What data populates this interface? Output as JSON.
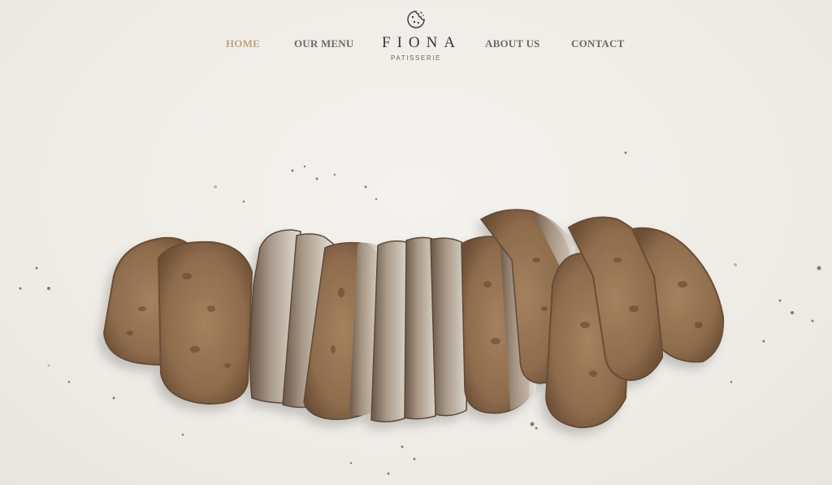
{
  "nav": {
    "home": "HOME",
    "menu": "OUR MENU",
    "about": "ABOUT US",
    "contact": "CONTACT"
  },
  "brand": {
    "name": "FIONA",
    "tagline": "PATISSERIE",
    "icon": "cookie-icon"
  },
  "colors": {
    "background": "#f1efeb",
    "nav_text": "#6f6a66",
    "nav_active": "#c2a37c",
    "brand_text": "#3a3633",
    "bread_crust": "#7a5a3e",
    "bread_crumb": "#9a7858"
  },
  "hero": {
    "image": "sliced-rye-bread-loaf"
  }
}
